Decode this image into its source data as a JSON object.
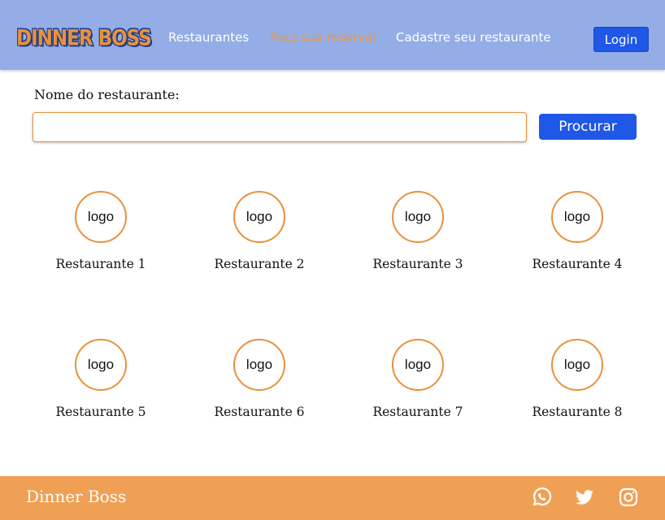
{
  "header": {
    "logo_text": "DINNER BOSS",
    "nav": [
      {
        "label": "Restaurantes",
        "active": false
      },
      {
        "label": "Faça sua reserva!",
        "active": true
      },
      {
        "label": "Cadastre seu restaurante",
        "active": false
      }
    ],
    "login_label": "Login"
  },
  "search": {
    "label": "Nome do restaurante:",
    "value": "",
    "placeholder": "",
    "button_label": "Procurar"
  },
  "restaurants": [
    {
      "logo": "logo",
      "name": "Restaurante 1"
    },
    {
      "logo": "logo",
      "name": "Restaurante 2"
    },
    {
      "logo": "logo",
      "name": "Restaurante 3"
    },
    {
      "logo": "logo",
      "name": "Restaurante 4"
    },
    {
      "logo": "logo",
      "name": "Restaurante 5"
    },
    {
      "logo": "logo",
      "name": "Restaurante 6"
    },
    {
      "logo": "logo",
      "name": "Restaurante 7"
    },
    {
      "logo": "logo",
      "name": "Restaurante 8"
    }
  ],
  "footer": {
    "title": "Dinner Boss",
    "social": [
      "whatsapp-icon",
      "twitter-icon",
      "instagram-icon"
    ]
  },
  "colors": {
    "header_bg": "#94ade6",
    "accent_orange": "#e8913c",
    "button_blue": "#1f57e6",
    "footer_bg": "#f0a055"
  }
}
